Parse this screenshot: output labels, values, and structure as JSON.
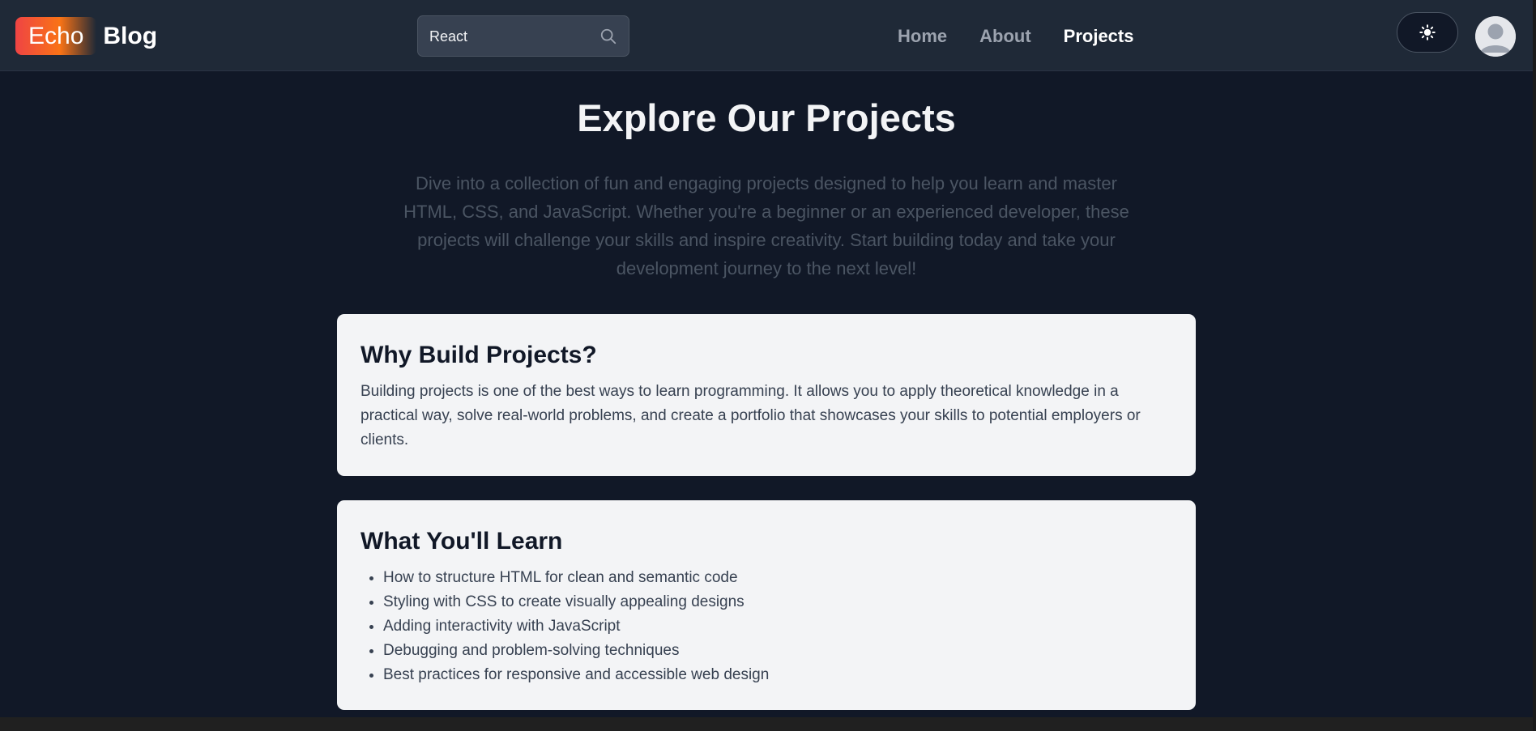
{
  "header": {
    "brand_echo": "Echo",
    "brand_blog": "Blog",
    "search_value": "React",
    "nav": [
      "Home",
      "About",
      "Projects"
    ],
    "active_nav": "Projects",
    "theme_icon": "sun-icon",
    "avatar_icon": "user-avatar-icon"
  },
  "main": {
    "title": "Explore Our Projects",
    "intro": "Dive into a collection of fun and engaging projects designed to help you learn and master HTML, CSS, and JavaScript. Whether you're a beginner or an experienced developer, these projects will challenge your skills and inspire creativity. Start building today and take your development journey to the next level!",
    "cards": [
      {
        "title": "Why Build Projects?",
        "body": "Building projects is one of the best ways to learn programming. It allows you to apply theoretical knowledge in a practical way, solve real-world problems, and create a portfolio that showcases your skills to potential employers or clients."
      },
      {
        "title": "What You'll Learn",
        "items": [
          "How to structure HTML for clean and semantic code",
          "Styling with CSS to create visually appealing designs",
          "Adding interactivity with JavaScript",
          "Debugging and problem-solving techniques",
          "Best practices for responsive and accessible web design"
        ]
      }
    ]
  },
  "colors": {
    "background": "#111827",
    "navbar": "#1f2937",
    "card": "#f3f4f6",
    "accent_start": "#ef4444",
    "accent_end": "#f97316"
  }
}
